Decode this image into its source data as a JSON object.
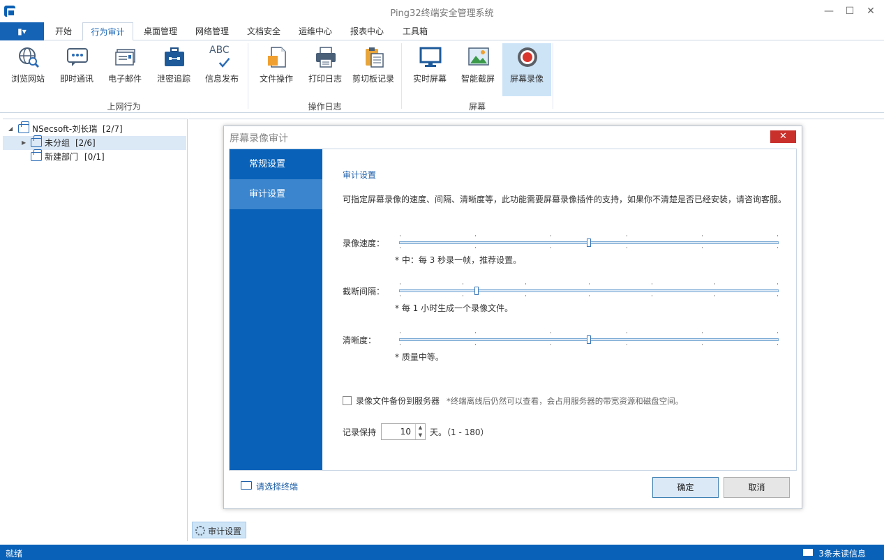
{
  "window": {
    "title": "Ping32终端安全管理系统",
    "minimize": "—",
    "maximize": "☐",
    "close": "✕"
  },
  "menu": {
    "file_label": "▮▾",
    "tabs": [
      {
        "label": "开始"
      },
      {
        "label": "行为审计"
      },
      {
        "label": "桌面管理"
      },
      {
        "label": "网络管理"
      },
      {
        "label": "文档安全"
      },
      {
        "label": "运维中心"
      },
      {
        "label": "报表中心"
      },
      {
        "label": "工具箱"
      }
    ]
  },
  "ribbon": {
    "groups": [
      {
        "label": "上网行为"
      },
      {
        "label": "操作日志"
      },
      {
        "label": "屏幕"
      }
    ],
    "buttons": [
      {
        "label": "浏览网站",
        "icon": "browse-web-icon"
      },
      {
        "label": "即时通讯",
        "icon": "instant-messaging-icon"
      },
      {
        "label": "电子邮件",
        "icon": "email-icon"
      },
      {
        "label": "泄密追踪",
        "icon": "leak-tracking-icon"
      },
      {
        "label": "信息发布",
        "icon": "info-publish-icon"
      },
      {
        "label": "文件操作",
        "icon": "file-operation-icon"
      },
      {
        "label": "打印日志",
        "icon": "print-log-icon"
      },
      {
        "label": "剪切板记录",
        "icon": "clipboard-icon"
      },
      {
        "label": "实时屏幕",
        "icon": "realtime-screen-icon"
      },
      {
        "label": "智能截屏",
        "icon": "smart-screenshot-icon"
      },
      {
        "label": "屏幕录像",
        "icon": "screen-record-icon"
      }
    ],
    "abc_text": "ABC"
  },
  "tree": {
    "root": {
      "label": "NSecsoft-刘长瑞",
      "count": "[2/7]"
    },
    "children": [
      {
        "label": "未分组",
        "count": "[2/6]"
      },
      {
        "label": "新建部门",
        "count": "[0/1]"
      }
    ]
  },
  "dialog": {
    "title": "屏幕录像审计",
    "close": "✕",
    "sidebar": [
      {
        "label": "常规设置"
      },
      {
        "label": "审计设置"
      }
    ],
    "section_title": "审计设置",
    "description": "可指定屏幕录像的速度、间隔、清晰度等，此功能需要屏幕录像插件的支持，如果你不清楚是否已经安装，请咨询客服。",
    "sliders": [
      {
        "label": "录像速度：",
        "note": "* 中：每 3 秒录一帧，推荐设置。",
        "value": 0.5
      },
      {
        "label": "截断间隔：",
        "note": "* 每 1 小时生成一个录像文件。",
        "value": 0.2
      },
      {
        "label": "清晰度：",
        "note": "* 质量中等。",
        "value": 0.5
      }
    ],
    "backup_checkbox": {
      "label": "录像文件备份到服务器",
      "note": "*终端离线后仍然可以查看，会占用服务器的带宽资源和磁盘空间。",
      "checked": false
    },
    "keep": {
      "label": "记录保持",
      "value": "10",
      "unit": "天。（1 - 180）"
    },
    "select_terminal": "请选择终端",
    "ok": "确定",
    "cancel": "取消"
  },
  "bottom_tab": {
    "label": "审计设置"
  },
  "status": {
    "left": "就绪",
    "right": "3条未读信息"
  },
  "colors": {
    "accent": "#0a62b8",
    "sidebar_active": "#3a85cd",
    "close_red": "#c9302c"
  }
}
